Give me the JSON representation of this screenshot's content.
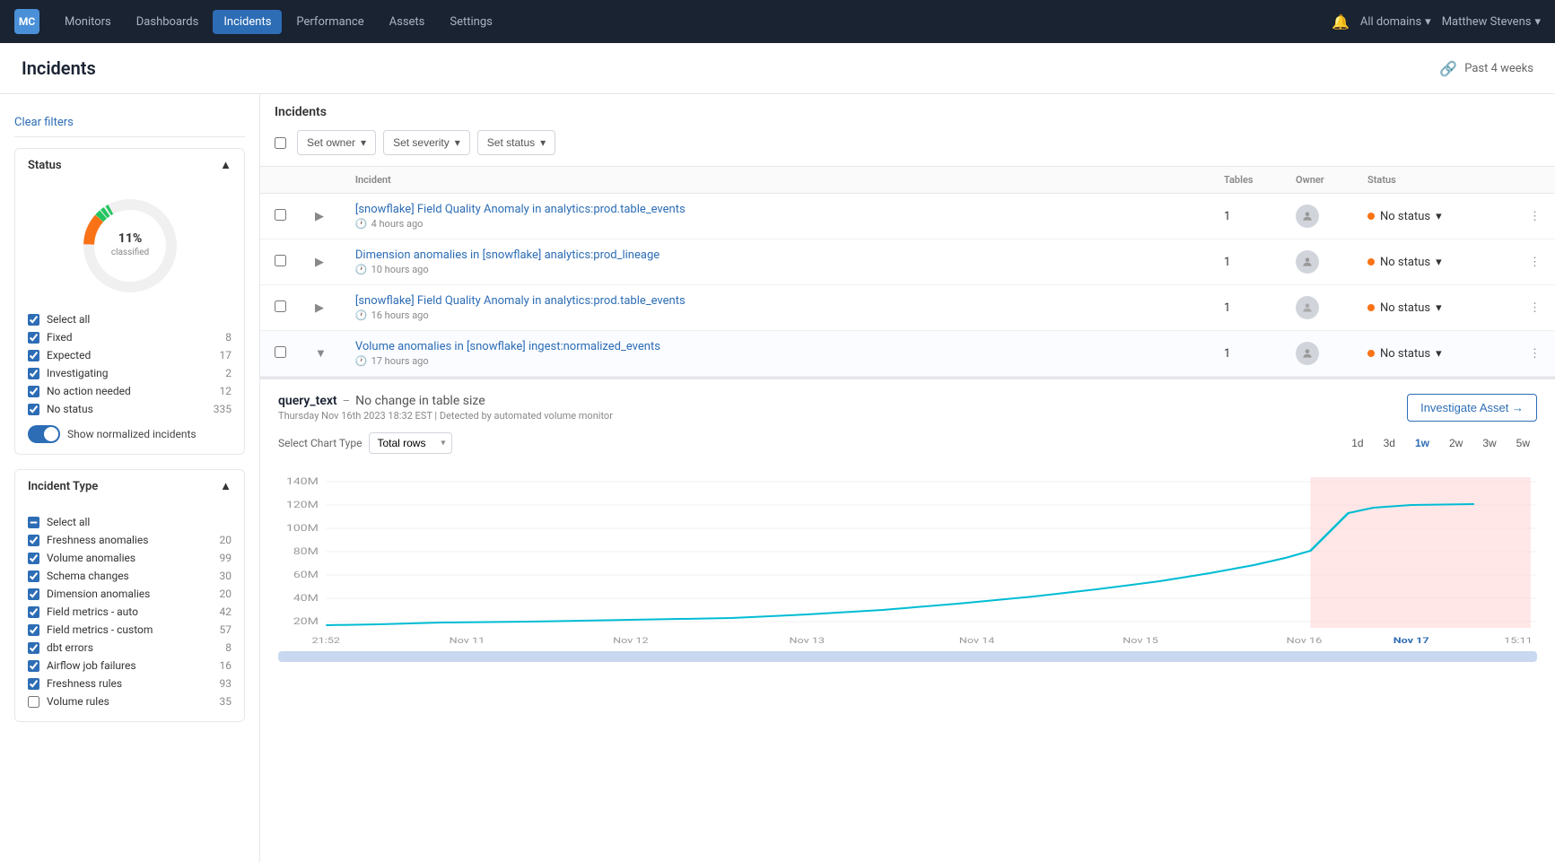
{
  "topnav": {
    "logo": "MC",
    "items": [
      {
        "label": "Monitors",
        "active": false
      },
      {
        "label": "Dashboards",
        "active": false
      },
      {
        "label": "Incidents",
        "active": true
      },
      {
        "label": "Performance",
        "active": false
      },
      {
        "label": "Assets",
        "active": false
      },
      {
        "label": "Settings",
        "active": false
      }
    ],
    "bell_label": "🔔",
    "domain_label": "All domains",
    "user_label": "Matthew Stevens"
  },
  "page": {
    "title": "Incidents",
    "time_range": "Past 4 weeks"
  },
  "sidebar": {
    "clear_label": "Clear filters",
    "status_section": {
      "title": "Status",
      "donut": {
        "classified_pct": 11,
        "label": "11%",
        "sublabel": "classified"
      },
      "items": [
        {
          "label": "Select all",
          "checked": true,
          "count": null
        },
        {
          "label": "Fixed",
          "checked": true,
          "count": "8"
        },
        {
          "label": "Expected",
          "checked": true,
          "count": "17"
        },
        {
          "label": "Investigating",
          "checked": true,
          "count": "2"
        },
        {
          "label": "No action needed",
          "checked": true,
          "count": "12"
        },
        {
          "label": "No status",
          "checked": true,
          "count": "335"
        }
      ],
      "toggle_label": "Show normalized incidents",
      "toggle_on": true
    },
    "incident_type_section": {
      "title": "Incident Type",
      "items": [
        {
          "label": "Select all",
          "checked": "indeterminate",
          "count": null
        },
        {
          "label": "Freshness anomalies",
          "checked": true,
          "count": "20"
        },
        {
          "label": "Volume anomalies",
          "checked": true,
          "count": "99"
        },
        {
          "label": "Schema changes",
          "checked": true,
          "count": "30"
        },
        {
          "label": "Dimension anomalies",
          "checked": true,
          "count": "20"
        },
        {
          "label": "Field metrics - auto",
          "checked": true,
          "count": "42"
        },
        {
          "label": "Field metrics - custom",
          "checked": true,
          "count": "57"
        },
        {
          "label": "dbt errors",
          "checked": true,
          "count": "8"
        },
        {
          "label": "Airflow job failures",
          "checked": true,
          "count": "16"
        },
        {
          "label": "Freshness rules",
          "checked": true,
          "count": "93"
        },
        {
          "label": "Volume rules",
          "checked": false,
          "count": "35"
        }
      ]
    }
  },
  "incidents_panel": {
    "title": "Incidents",
    "toolbar": {
      "set_owner_label": "Set owner",
      "set_severity_label": "Set severity",
      "set_status_label": "Set status"
    },
    "table_headers": [
      "",
      "",
      "Incident",
      "Tables",
      "Owner",
      "Status"
    ],
    "rows": [
      {
        "id": 1,
        "title": "[snowflake] Field Quality Anomaly in analytics:prod.table_events",
        "time": "4 hours ago",
        "tables": "1",
        "status": "No status",
        "expanded": false
      },
      {
        "id": 2,
        "title": "Dimension anomalies in [snowflake] analytics:prod_lineage",
        "time": "10 hours ago",
        "tables": "1",
        "status": "No status",
        "expanded": false
      },
      {
        "id": 3,
        "title": "[snowflake] Field Quality Anomaly in analytics:prod.table_events",
        "time": "16 hours ago",
        "tables": "1",
        "status": "No status",
        "expanded": false
      },
      {
        "id": 4,
        "title": "Volume anomalies in [snowflake] ingest:normalized_events",
        "time": "17 hours ago",
        "tables": "1",
        "status": "No status",
        "expanded": true
      }
    ]
  },
  "detail_panel": {
    "chart_type_label": "Select Chart Type",
    "chart_type_value": "Total rows",
    "title": "query_text",
    "subtitle_dash": "No change in table size",
    "detected_text": "Thursday Nov 16th 2023 18:32 EST",
    "detected_by": "Detected by automated volume monitor",
    "investigate_btn_label": "Investigate Asset →",
    "time_buttons": [
      "1d",
      "3d",
      "1w",
      "2w",
      "3w",
      "5w"
    ],
    "active_time": "1w",
    "y_labels": [
      "140M",
      "120M",
      "100M",
      "80M",
      "60M",
      "40M",
      "20M"
    ],
    "x_labels": [
      "21:52",
      "Nov 11",
      "Nov 12",
      "Nov 13",
      "Nov 14",
      "Nov 15",
      "Nov 16",
      "Nov 17",
      "15:11"
    ],
    "chart_colors": {
      "line": "#00bcd4",
      "anomaly_fill": "#ffd7d7",
      "line_stroke": "#00acc1"
    }
  }
}
